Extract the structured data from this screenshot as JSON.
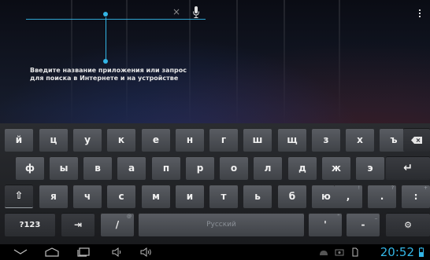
{
  "search": {
    "hint_line1": "Введите название приложения или запрос",
    "hint_line2": "для поиска в Интернете и на устройстве",
    "clear_glyph": "×"
  },
  "keyboard": {
    "row1": [
      "й",
      "ц",
      "у",
      "к",
      "е",
      "н",
      "г",
      "ш",
      "щ",
      "з",
      "х",
      "ъ"
    ],
    "row2": [
      "ф",
      "ы",
      "в",
      "а",
      "п",
      "р",
      "о",
      "л",
      "д",
      "ж",
      "э"
    ],
    "row3": [
      "я",
      "ч",
      "с",
      "м",
      "и",
      "т",
      "ь",
      "б",
      "ю"
    ],
    "row3_punct": [
      {
        "main": ",",
        "sup": "!"
      },
      {
        "main": ".",
        "sup": "?"
      },
      {
        "main": ":",
        "sup": "+"
      }
    ],
    "slash": {
      "main": "/",
      "sup": "@"
    },
    "apostrophe": {
      "main": "'",
      "sup": "\""
    },
    "dash": {
      "main": "-",
      "sup": "_"
    },
    "symbols_label": "?123",
    "space_label": "Русский",
    "tab_glyph": "⇥",
    "enter_glyph": "↵",
    "shift_glyph": "⇧",
    "settings_glyph": "⚙"
  },
  "status": {
    "time": "20:52"
  },
  "colors": {
    "accent": "#33b5e5",
    "key_bg": "#4a4d52",
    "keyboard_bg": "#1f2023"
  }
}
